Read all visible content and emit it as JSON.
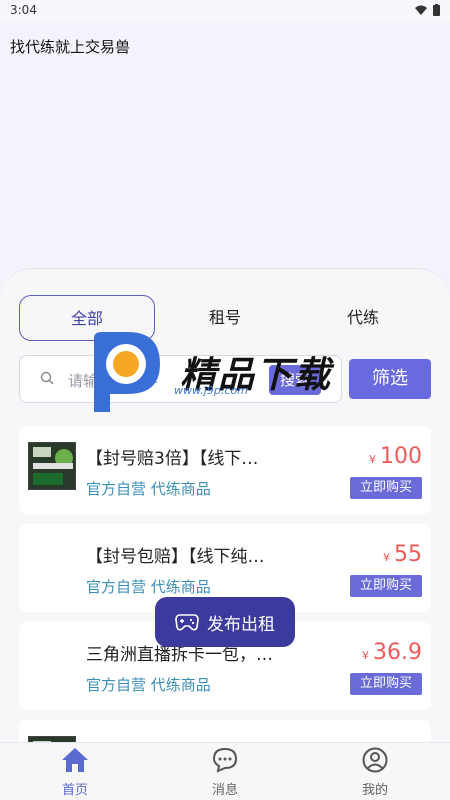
{
  "status_bar": {
    "time": "3:04"
  },
  "header": {
    "title": "找代练就上交易兽"
  },
  "tabs": [
    {
      "label": "全部",
      "active": true
    },
    {
      "label": "租号",
      "active": false
    },
    {
      "label": "代练",
      "active": false
    }
  ],
  "search": {
    "placeholder": "请输入关键字",
    "button_label": "搜索"
  },
  "filter": {
    "label": "筛选"
  },
  "currency": "¥",
  "listings": [
    {
      "title": "【封号赔3倍】【线下…",
      "tags": "官方自营 代练商品",
      "price": "100",
      "buy_label": "立即购买"
    },
    {
      "title": "【封号包赔】【线下纯…",
      "tags": "官方自营 代练商品",
      "price": "55",
      "buy_label": "立即购买"
    },
    {
      "title": "三角洲直播拆卡一包，…",
      "tags": "官方自营 代练商品",
      "price": "36.9",
      "buy_label": "立即购买"
    },
    {
      "title": "",
      "tags": "",
      "price": "",
      "buy_label": ""
    }
  ],
  "fab": {
    "label": "发布出租"
  },
  "watermark": {
    "text": "精品下载",
    "url": "www.j9p.com"
  },
  "bottom_nav": [
    {
      "label": "首页",
      "icon": "home-icon",
      "active": true
    },
    {
      "label": "消息",
      "icon": "message-icon",
      "active": false
    },
    {
      "label": "我的",
      "icon": "profile-icon",
      "active": false
    }
  ],
  "colors": {
    "accent": "#6a6ad8",
    "price": "#f05a5a",
    "tag": "#3b8fb8",
    "fab": "#3c3a9c"
  }
}
